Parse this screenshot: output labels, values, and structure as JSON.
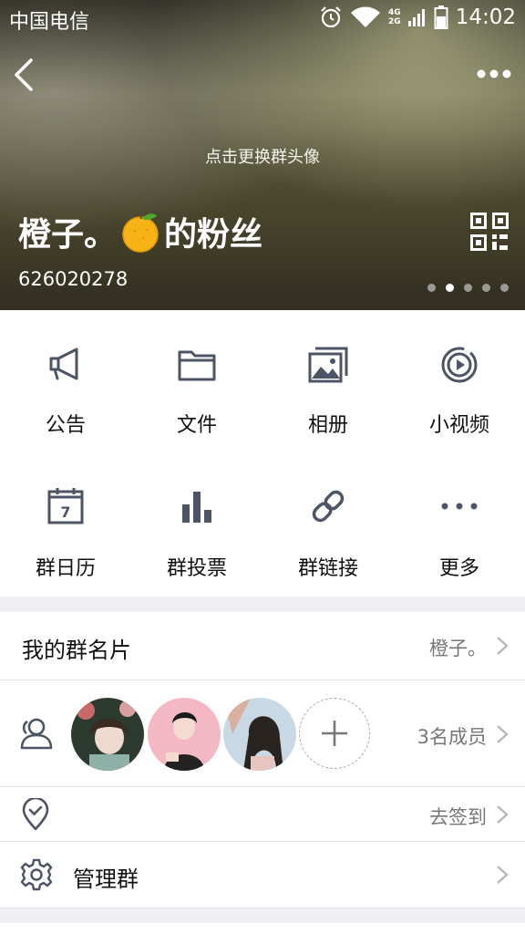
{
  "status_bar": {
    "carrier": "中国电信",
    "network_top": "4G",
    "network_bottom": "2G",
    "time": "14:02"
  },
  "header": {
    "change_avatar_hint": "点击更换群头像",
    "group_name_prefix": "橙子。",
    "group_name_suffix": "的粉丝",
    "group_id": "626020278",
    "page_indicator": {
      "count": 5,
      "active_index": 1
    }
  },
  "features": [
    {
      "label": "公告",
      "icon": "megaphone-icon"
    },
    {
      "label": "文件",
      "icon": "folder-icon"
    },
    {
      "label": "相册",
      "icon": "photo-album-icon"
    },
    {
      "label": "小视频",
      "icon": "video-play-icon"
    },
    {
      "label": "群日历",
      "icon": "calendar-icon"
    },
    {
      "label": "群投票",
      "icon": "bar-chart-icon"
    },
    {
      "label": "群链接",
      "icon": "link-icon"
    },
    {
      "label": "更多",
      "icon": "more-dots-icon"
    }
  ],
  "calendar_day": "7",
  "my_card": {
    "label": "我的群名片",
    "value": "橙子。"
  },
  "members": {
    "count_label": "3名成员"
  },
  "checkin": {
    "label": "去签到"
  },
  "manage": {
    "label": "管理群"
  },
  "colors": {
    "icon_gray": "#4d5466",
    "accent_blue": "#12b7f5"
  }
}
